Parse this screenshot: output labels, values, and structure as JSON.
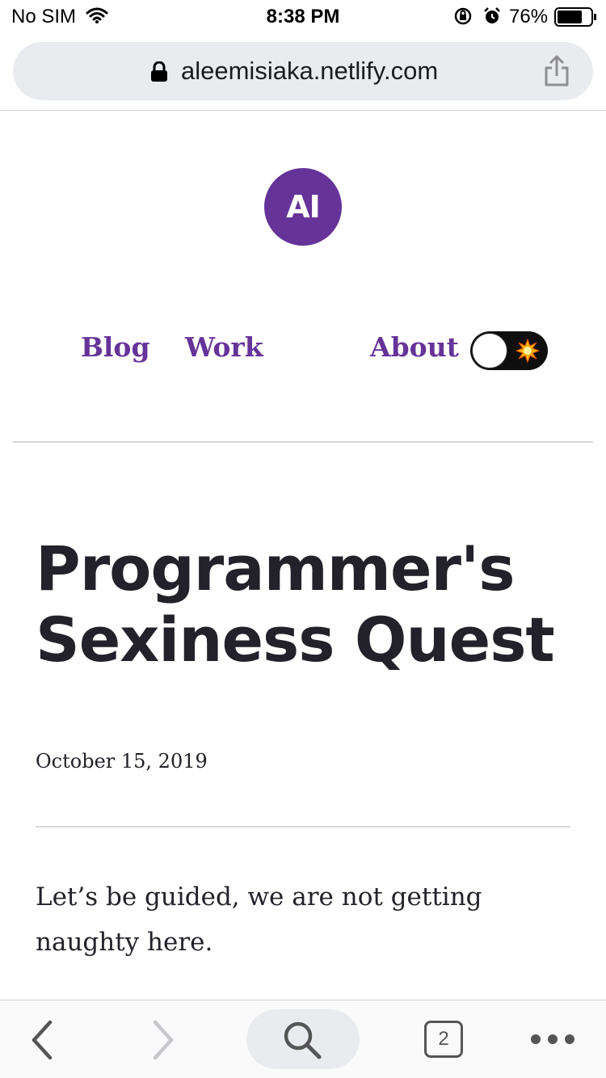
{
  "status_bar": {
    "carrier": "No SIM",
    "time": "8:38 PM",
    "battery_percent": "76%",
    "battery_level": 0.76
  },
  "browser": {
    "url": "aleemisiaka.netlify.com",
    "tab_count": "2"
  },
  "site": {
    "logo_text": "AI",
    "nav": {
      "blog": "Blog",
      "work": "Work",
      "about": "About"
    },
    "theme_toggle": {
      "state": "light"
    }
  },
  "article": {
    "title": "Programmer's Sexiness Quest",
    "date": "October 15, 2019",
    "body": "Let’s be guided, we are not getting naughty here."
  },
  "colors": {
    "brand": "#663399",
    "text": "#232129"
  }
}
